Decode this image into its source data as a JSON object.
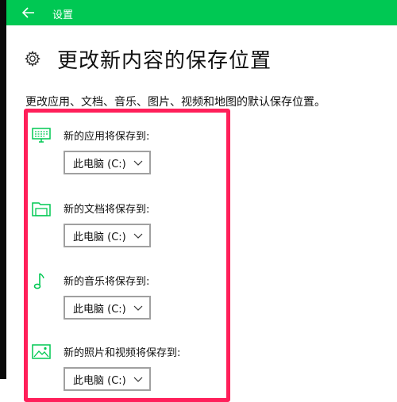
{
  "window": {
    "title": "设置"
  },
  "page": {
    "title": "更改新内容的保存位置",
    "description": "更改应用、文档、音乐、图片、视频和地图的默认保存位置。"
  },
  "sections": [
    {
      "label": "新的应用将保存到:",
      "value": "此电脑 (C:)",
      "icon": "monitor-icon"
    },
    {
      "label": "新的文档将保存到:",
      "value": "此电脑 (C:)",
      "icon": "folder-icon"
    },
    {
      "label": "新的音乐将保存到:",
      "value": "此电脑 (C:)",
      "icon": "music-note-icon"
    },
    {
      "label": "新的照片和视频将保存到:",
      "value": "此电脑 (C:)",
      "icon": "picture-icon"
    }
  ],
  "colors": {
    "titlebar": "#00c853",
    "accent_icon": "#00c853",
    "highlight": "#ff1f5a"
  }
}
